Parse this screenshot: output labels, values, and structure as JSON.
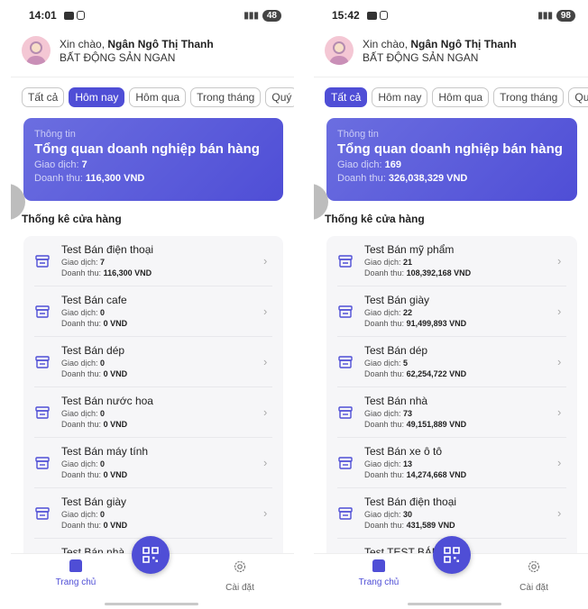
{
  "screens": [
    {
      "status": {
        "time": "14:01",
        "battery": "48"
      },
      "greeting": {
        "hello": "Xin chào,",
        "name": "Ngân Ngô Thị Thanh",
        "business": "BẤT ĐỘNG SẢN NGAN"
      },
      "tabs": [
        "Tất cả",
        "Hôm nay",
        "Hôm qua",
        "Trong tháng",
        "Quý"
      ],
      "active_tab": "Hôm nay",
      "overview": {
        "caption": "Thông tin",
        "title": "Tổng quan doanh nghiệp bán hàng",
        "tx_label": "Giao dịch:",
        "tx_value": "7",
        "rev_label": "Doanh thu:",
        "rev_value": "116,300 VND"
      },
      "section_title": "Thống kê cửa hàng",
      "stores": [
        {
          "name": "Test Bán điện thoại",
          "tx": "7",
          "rev": "116,300 VND"
        },
        {
          "name": "Test Bán cafe",
          "tx": "0",
          "rev": "0 VND"
        },
        {
          "name": "Test Bán dép",
          "tx": "0",
          "rev": "0 VND"
        },
        {
          "name": "Test Bán nước hoa",
          "tx": "0",
          "rev": "0 VND"
        },
        {
          "name": "Test Bán máy tính",
          "tx": "0",
          "rev": "0 VND"
        },
        {
          "name": "Test Bán giày",
          "tx": "0",
          "rev": "0 VND"
        },
        {
          "name": "Test Bán nhà",
          "tx": "",
          "rev": ""
        }
      ],
      "nav": {
        "home": "Trang chủ",
        "settings": "Cài đặt"
      }
    },
    {
      "status": {
        "time": "15:42",
        "battery": "98"
      },
      "greeting": {
        "hello": "Xin chào,",
        "name": "Ngân Ngô Thị Thanh",
        "business": "BẤT ĐỘNG SẢN NGAN"
      },
      "tabs": [
        "Tất cả",
        "Hôm nay",
        "Hôm qua",
        "Trong tháng",
        "Quý"
      ],
      "active_tab": "Tất cả",
      "overview": {
        "caption": "Thông tin",
        "title": "Tổng quan doanh nghiệp bán hàng",
        "tx_label": "Giao dịch:",
        "tx_value": "169",
        "rev_label": "Doanh thu:",
        "rev_value": "326,038,329 VND"
      },
      "section_title": "Thống kê cửa hàng",
      "stores": [
        {
          "name": "Test Bán mỹ phẩm",
          "tx": "21",
          "rev": "108,392,168 VND"
        },
        {
          "name": "Test Bán giày",
          "tx": "22",
          "rev": "91,499,893 VND"
        },
        {
          "name": "Test Bán dép",
          "tx": "5",
          "rev": "62,254,722 VND"
        },
        {
          "name": "Test Bán nhà",
          "tx": "73",
          "rev": "49,151,889 VND"
        },
        {
          "name": "Test Bán xe ô tô",
          "tx": "13",
          "rev": "14,274,668 VND"
        },
        {
          "name": "Test Bán điện thoại",
          "tx": "30",
          "rev": "431,589 VND"
        },
        {
          "name": "Test TEST BÁN Q    D",
          "tx": "",
          "rev": ""
        }
      ],
      "nav": {
        "home": "Trang chủ",
        "settings": "Cài đặt"
      }
    }
  ],
  "labels": {
    "tx": "Giao dịch:",
    "rev": "Doanh thu:"
  },
  "colors": {
    "accent": "#4f4ed6",
    "list_bg": "#f6f6f8"
  },
  "icons": {
    "store": "store-icon",
    "qr": "qr-code-icon",
    "home": "home-icon",
    "settings": "settings-gear-icon",
    "chevron": "chevron-right-icon"
  }
}
